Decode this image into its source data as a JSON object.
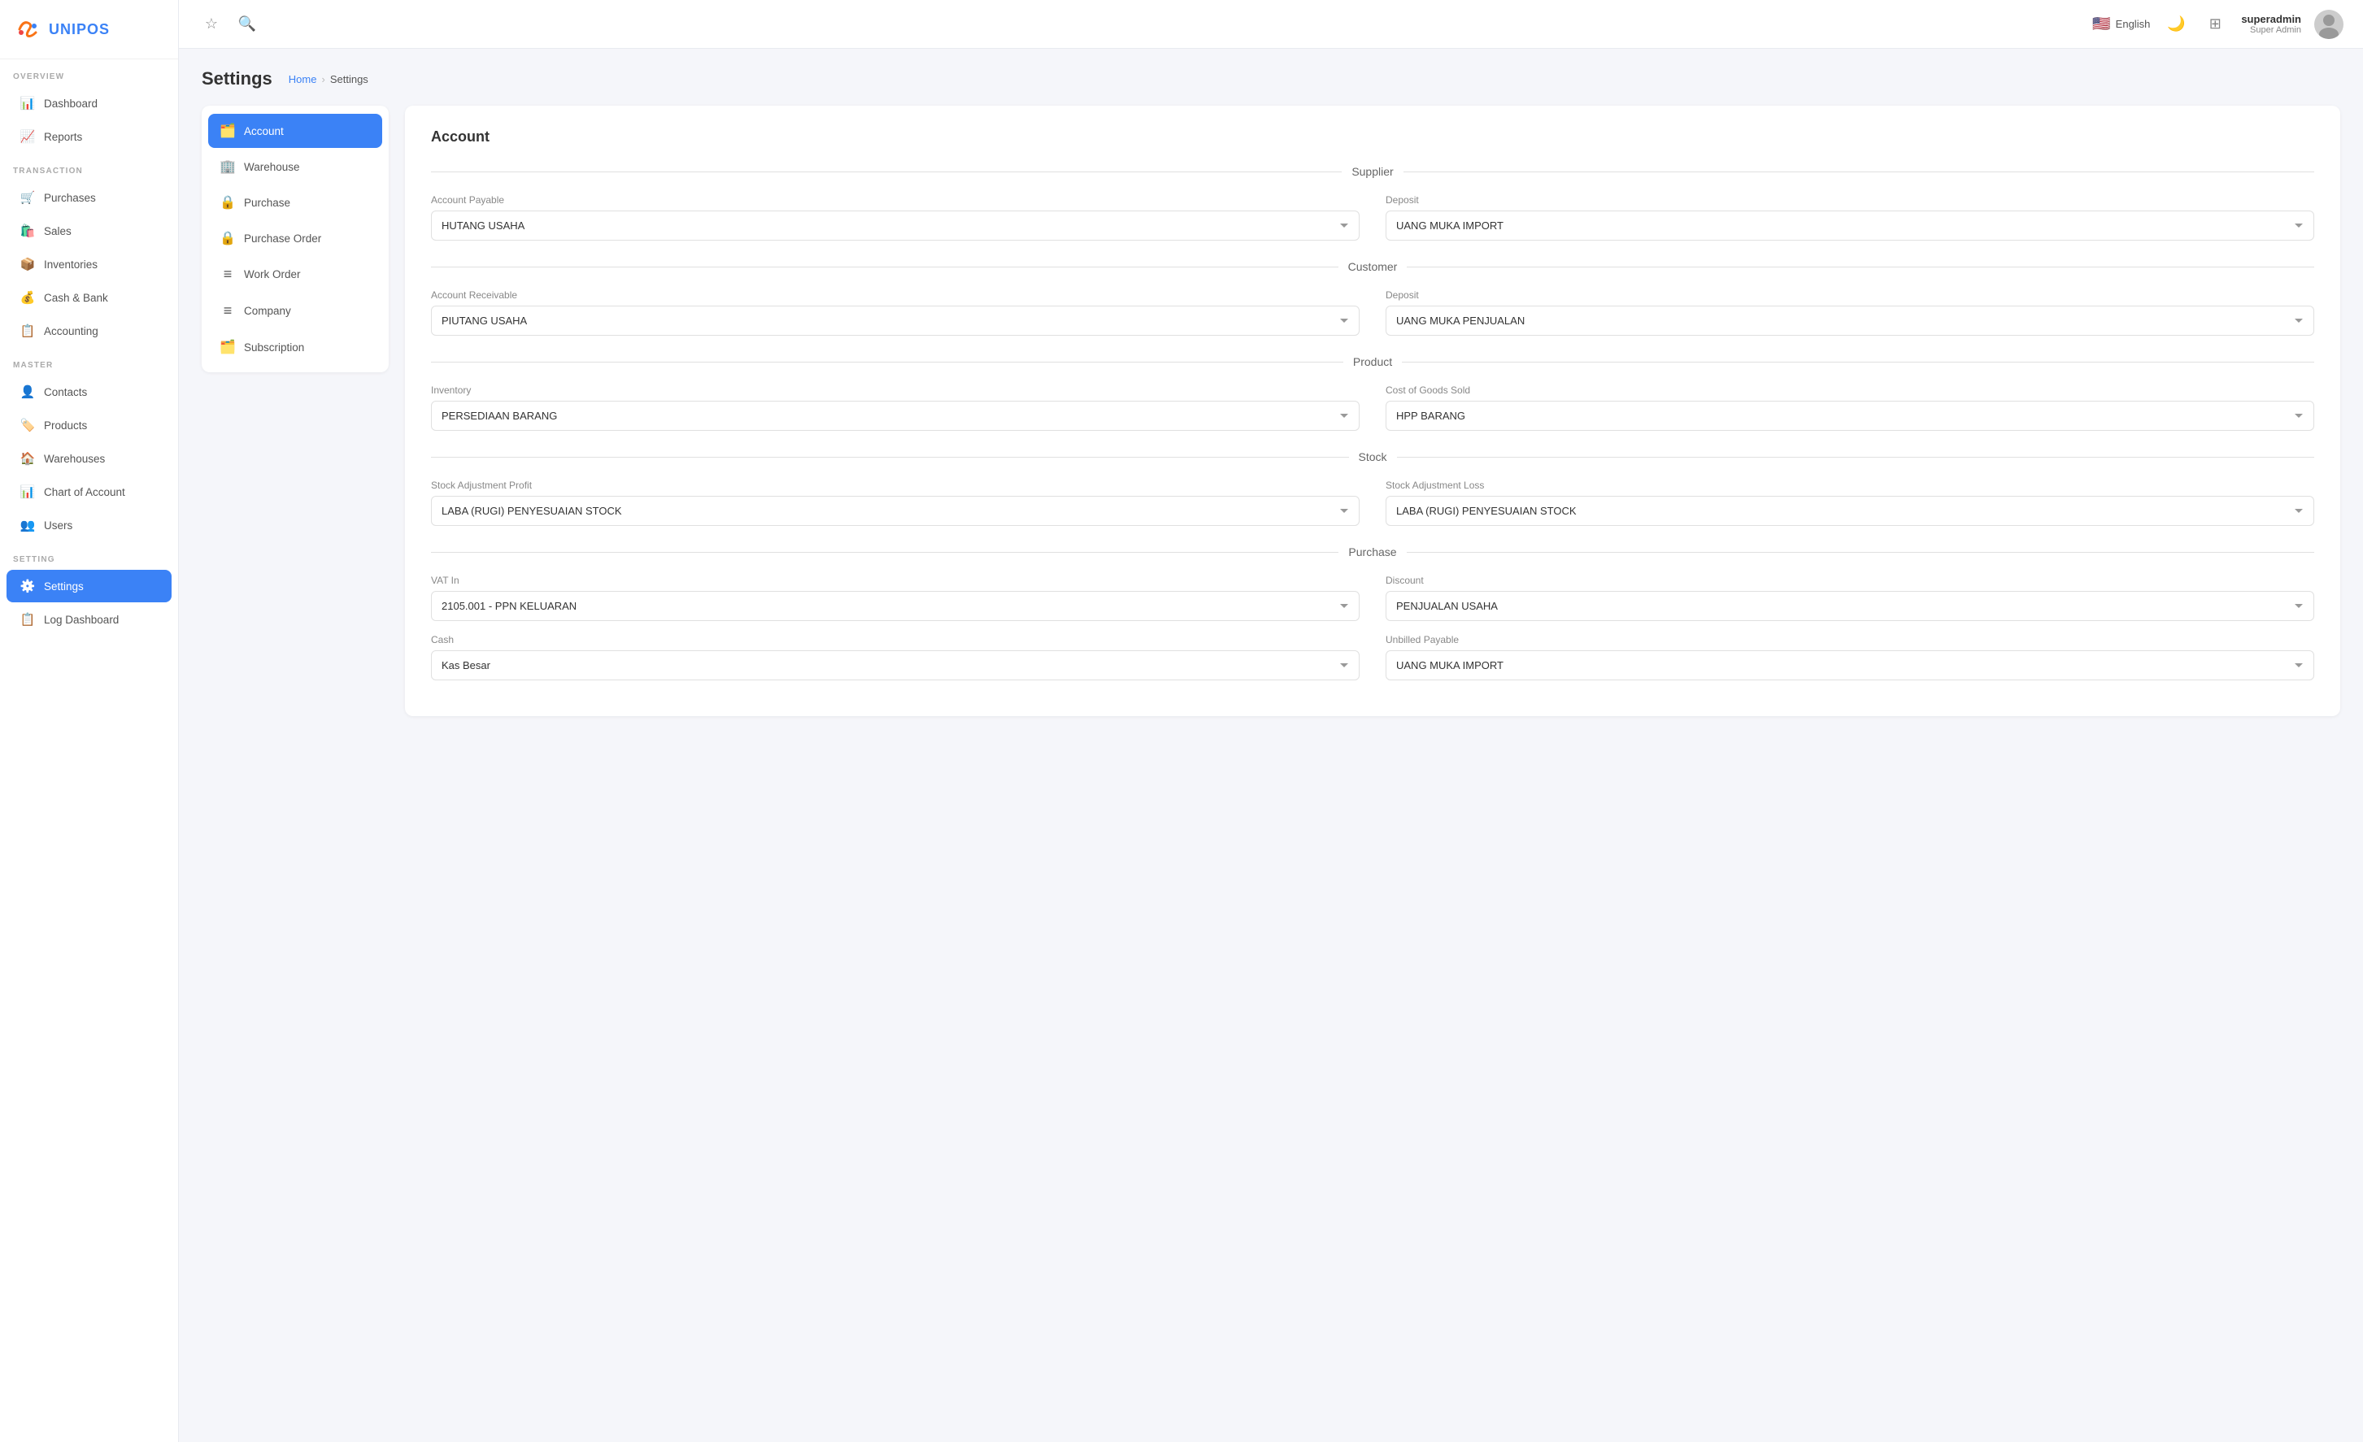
{
  "app": {
    "logo_text": "UNIPOS"
  },
  "topbar": {
    "lang_label": "English",
    "user_name": "superadmin",
    "user_role": "Super Admin"
  },
  "sidebar": {
    "sections": [
      {
        "label": "OVERVIEW",
        "items": [
          {
            "id": "dashboard",
            "label": "Dashboard",
            "icon": "📊"
          },
          {
            "id": "reports",
            "label": "Reports",
            "icon": "📈"
          }
        ]
      },
      {
        "label": "TRANSACTION",
        "items": [
          {
            "id": "purchases",
            "label": "Purchases",
            "icon": "🛒"
          },
          {
            "id": "sales",
            "label": "Sales",
            "icon": "🛍️"
          },
          {
            "id": "inventories",
            "label": "Inventories",
            "icon": "📦"
          },
          {
            "id": "cash-bank",
            "label": "Cash & Bank",
            "icon": "💰"
          },
          {
            "id": "accounting",
            "label": "Accounting",
            "icon": "📋"
          }
        ]
      },
      {
        "label": "MASTER",
        "items": [
          {
            "id": "contacts",
            "label": "Contacts",
            "icon": "👤"
          },
          {
            "id": "products",
            "label": "Products",
            "icon": "🏷️"
          },
          {
            "id": "warehouses",
            "label": "Warehouses",
            "icon": "🏠"
          },
          {
            "id": "chart-of-account",
            "label": "Chart of Account",
            "icon": "📊"
          },
          {
            "id": "users",
            "label": "Users",
            "icon": "👥"
          }
        ]
      },
      {
        "label": "SETTING",
        "items": [
          {
            "id": "settings",
            "label": "Settings",
            "icon": "⚙️",
            "active": true
          },
          {
            "id": "log-dashboard",
            "label": "Log Dashboard",
            "icon": "📋"
          }
        ]
      }
    ]
  },
  "breadcrumb": {
    "home": "Home",
    "current": "Settings"
  },
  "page_title": "Settings",
  "settings_nav": {
    "items": [
      {
        "id": "account",
        "label": "Account",
        "icon": "🗂️",
        "active": true
      },
      {
        "id": "warehouse",
        "label": "Warehouse",
        "icon": "🏢"
      },
      {
        "id": "purchase",
        "label": "Purchase",
        "icon": "🔒"
      },
      {
        "id": "purchase-order",
        "label": "Purchase Order",
        "icon": "🔒"
      },
      {
        "id": "work-order",
        "label": "Work Order",
        "icon": "≡"
      },
      {
        "id": "company",
        "label": "Company",
        "icon": "≡"
      },
      {
        "id": "subscription",
        "label": "Subscription",
        "icon": "🗂️"
      }
    ]
  },
  "account_section": {
    "title": "Account",
    "supplier": {
      "label": "Supplier",
      "account_payable_label": "Account Payable",
      "account_payable_value": "HUTANG USAHA",
      "deposit_label": "Deposit",
      "deposit_value": "UANG MUKA IMPORT"
    },
    "customer": {
      "label": "Customer",
      "account_receivable_label": "Account Receivable",
      "account_receivable_value": "PIUTANG USAHA",
      "deposit_label": "Deposit",
      "deposit_value": "UANG MUKA PENJUALAN"
    },
    "product": {
      "label": "Product",
      "inventory_label": "Inventory",
      "inventory_value": "PERSEDIAAN BARANG",
      "cogs_label": "Cost of Goods Sold",
      "cogs_value": "HPP BARANG"
    },
    "stock": {
      "label": "Stock",
      "adj_profit_label": "Stock Adjustment Profit",
      "adj_profit_value": "LABA (RUGI) PENYESUAIAN STOCK",
      "adj_loss_label": "Stock Adjustment Loss",
      "adj_loss_value": "LABA (RUGI) PENYESUAIAN STOCK"
    },
    "purchase": {
      "label": "Purchase",
      "vat_in_label": "VAT In",
      "vat_in_value": "2105.001 - PPN KELUARAN",
      "discount_label": "Discount",
      "discount_value": "PENJUALAN USAHA",
      "cash_label": "Cash",
      "cash_value": "Kas Besar",
      "unbilled_payable_label": "Unbilled Payable",
      "unbilled_payable_value": "UANG MUKA IMPORT"
    }
  }
}
